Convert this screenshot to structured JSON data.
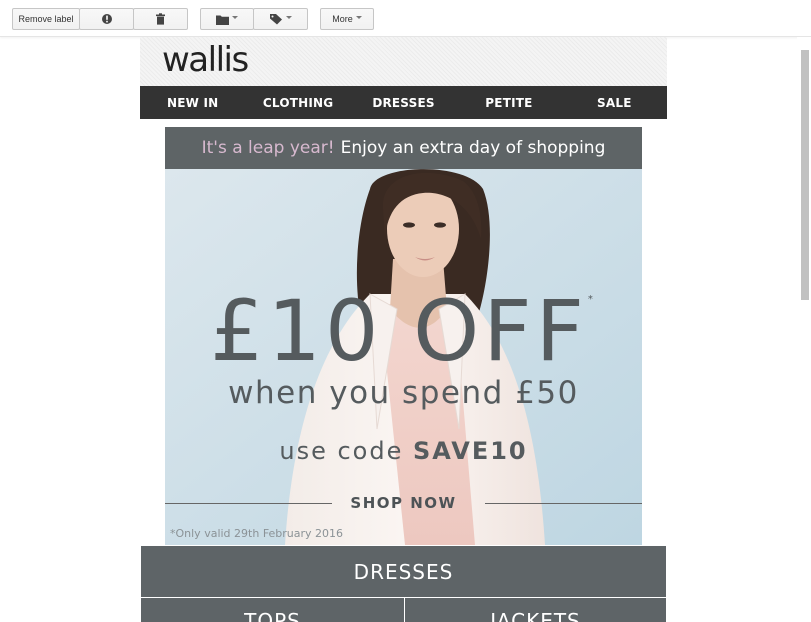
{
  "toolbar": {
    "remove_label": "Remove label",
    "report_spam_icon": "exclamation-icon",
    "delete_icon": "trash-icon",
    "move_to_icon": "folder-icon",
    "labels_icon": "tag-icon",
    "more_label": "More"
  },
  "brand": {
    "logo_text": "wallis"
  },
  "nav": {
    "items": [
      {
        "label": "NEW IN"
      },
      {
        "label": "CLOTHING"
      },
      {
        "label": "DRESSES"
      },
      {
        "label": "PETITE"
      },
      {
        "label": "SALE"
      }
    ]
  },
  "hero": {
    "banner_accent": "It's a leap year!",
    "banner_text": "Enjoy an extra day of shopping",
    "offer_amount": "£10 OFF",
    "offer_asterisk": "*",
    "offer_condition": "when you spend £50",
    "code_prefix": "use code",
    "code": "SAVE10",
    "cta": "SHOP NOW",
    "terms": "*Only valid 29th February 2016"
  },
  "categories": {
    "full": "DRESSES",
    "left": "TOPS",
    "right": "JACKETS"
  },
  "colors": {
    "nav_bg": "#333333",
    "banner_bg": "#5e6466",
    "banner_accent": "#d7b9cf",
    "category_bg": "#5e6467",
    "hero_bg": "#c8dde7"
  }
}
